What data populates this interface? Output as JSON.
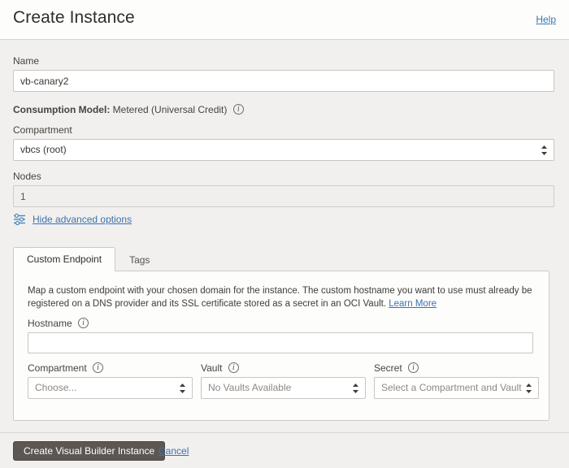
{
  "header": {
    "title": "Create Instance",
    "help_label": "Help"
  },
  "form": {
    "name": {
      "label": "Name",
      "value": "vb-canary2",
      "placeholder": ""
    },
    "consumption_model": {
      "label": "Consumption Model:",
      "value": "Metered (Universal Credit)",
      "info_icon": "info-icon"
    },
    "compartment": {
      "label": "Compartment",
      "value": "vbcs (root)"
    },
    "nodes": {
      "label": "Nodes",
      "value": "1"
    },
    "advanced_toggle": {
      "label": "Hide advanced options",
      "icon": "sliders-icon"
    }
  },
  "tabs": [
    {
      "label": "Custom Endpoint",
      "active": true
    },
    {
      "label": "Tags",
      "active": false
    }
  ],
  "custom_endpoint": {
    "description_part1": "Map a custom endpoint with your chosen domain for the instance. The custom hostname you want to use must already be registered on a DNS provider and its SSL certificate stored as a secret in an OCI Vault.",
    "learn_more_label": "Learn More",
    "hostname": {
      "label": "Hostname",
      "value": "",
      "placeholder": "",
      "info_icon": "info-icon"
    },
    "compartment": {
      "label": "Compartment",
      "value": "Choose...",
      "info_icon": "info-icon"
    },
    "vault": {
      "label": "Vault",
      "value": "No Vaults Available",
      "info_icon": "info-icon"
    },
    "secret": {
      "label": "Secret",
      "value": "Select a Compartment and Vault",
      "info_icon": "info-icon"
    }
  },
  "footer": {
    "submit_label": "Create Visual Builder Instance",
    "cancel_label": "Cancel"
  },
  "colors": {
    "link": "#3b73af",
    "primary_button_bg": "#5c5753",
    "page_bg": "#f1f0ee",
    "panel_bg": "#fdfdfc",
    "border": "#c9c5c1"
  }
}
